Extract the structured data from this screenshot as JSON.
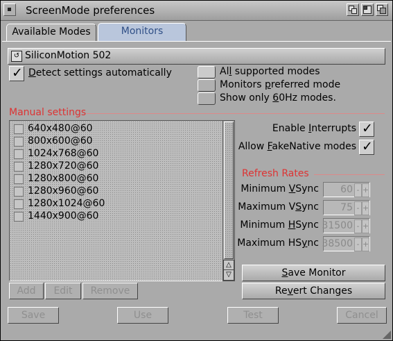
{
  "window": {
    "title": "ScreenMode preferences"
  },
  "tabs": [
    {
      "label": "Available Modes",
      "active": false
    },
    {
      "label": "Monitors",
      "active": true
    }
  ],
  "device": {
    "name": "SiliconMotion 502"
  },
  "detect": {
    "label_pre": "",
    "label_u": "D",
    "label_post": "etect settings automatically",
    "checked": true
  },
  "filters": [
    {
      "pre": "Al",
      "u": "l",
      "post": " supported modes",
      "selected": true
    },
    {
      "pre": "Monitors ",
      "u": "p",
      "post": "referred mode",
      "selected": false
    },
    {
      "pre": "Show only ",
      "u": "6",
      "post": "0Hz modes.",
      "selected": false
    }
  ],
  "manual": {
    "title": "Manual settings"
  },
  "modes": [
    "640x480@60",
    "800x600@60",
    "1024x768@60",
    "1280x720@60",
    "1280x800@60",
    "1280x960@60",
    "1280x1024@60",
    "1440x900@60"
  ],
  "list_buttons": {
    "add": "Add",
    "edit": "Edit",
    "remove": "Remove"
  },
  "options": {
    "interrupts": {
      "pre": "Enable ",
      "u": "I",
      "post": "nterrupts",
      "checked": true
    },
    "fakenative": {
      "pre": "Allow ",
      "u": "F",
      "post": "akeNative modes",
      "checked": true
    }
  },
  "refresh": {
    "title": "Refresh Rates",
    "rows": [
      {
        "pre": "Minimum ",
        "u": "V",
        "post": "Sync",
        "value": "60"
      },
      {
        "pre": "Maximum V",
        "u": "S",
        "post": "ync",
        "value": "75"
      },
      {
        "pre": "Minimum ",
        "u": "H",
        "post": "Sync",
        "value": "31500"
      },
      {
        "pre": "Maximum HS",
        "u": "y",
        "post": "nc",
        "value": "38500"
      }
    ],
    "minus": "-",
    "plus": "+"
  },
  "actions": {
    "save_monitor": {
      "pre": "",
      "u": "S",
      "post": "ave Monitor"
    },
    "revert": {
      "pre": "Re",
      "u": "v",
      "post": "ert Changes"
    }
  },
  "bottom": {
    "save": "Save",
    "use": "Use",
    "test": "Test",
    "cancel": "Cancel"
  }
}
